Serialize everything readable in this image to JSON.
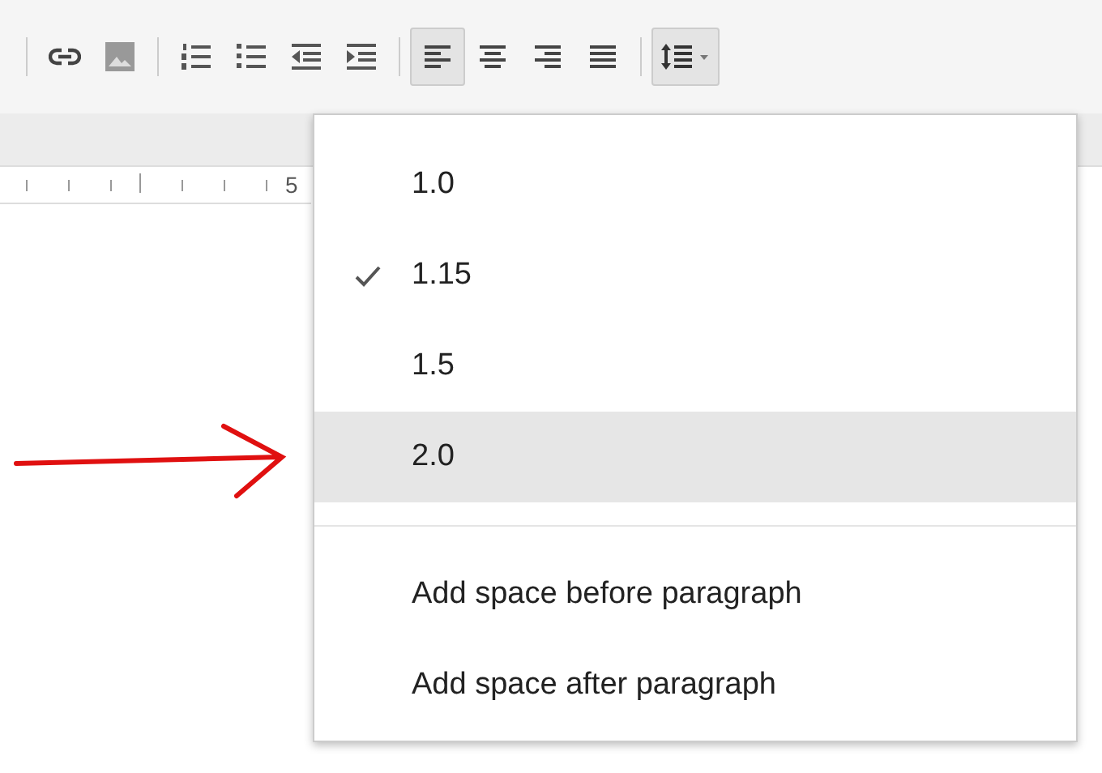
{
  "toolbar": {
    "groups": [
      [
        {
          "kind": "link",
          "selected": false
        },
        {
          "kind": "image",
          "selected": false
        }
      ],
      [
        {
          "kind": "numbered-list",
          "selected": false
        },
        {
          "kind": "bulleted-list",
          "selected": false
        },
        {
          "kind": "outdent",
          "selected": false
        },
        {
          "kind": "indent",
          "selected": false
        }
      ],
      [
        {
          "kind": "align-left",
          "selected": true
        },
        {
          "kind": "align-center",
          "selected": false
        },
        {
          "kind": "align-right",
          "selected": false
        },
        {
          "kind": "justify",
          "selected": false
        }
      ],
      [
        {
          "kind": "line-spacing",
          "selected": true
        }
      ]
    ]
  },
  "ruler": {
    "label": "5"
  },
  "line_spacing_menu": {
    "items": [
      {
        "kind": "option",
        "label": "1.0",
        "checked": false,
        "highlighted": false
      },
      {
        "kind": "option",
        "label": "1.15",
        "checked": true,
        "highlighted": false
      },
      {
        "kind": "option",
        "label": "1.5",
        "checked": false,
        "highlighted": false
      },
      {
        "kind": "option",
        "label": "2.0",
        "checked": false,
        "highlighted": true
      },
      {
        "kind": "divider"
      },
      {
        "kind": "action",
        "label": "Add space before paragraph",
        "checked": false,
        "highlighted": false
      },
      {
        "kind": "action",
        "label": "Add space after paragraph",
        "checked": false,
        "highlighted": false
      }
    ]
  }
}
